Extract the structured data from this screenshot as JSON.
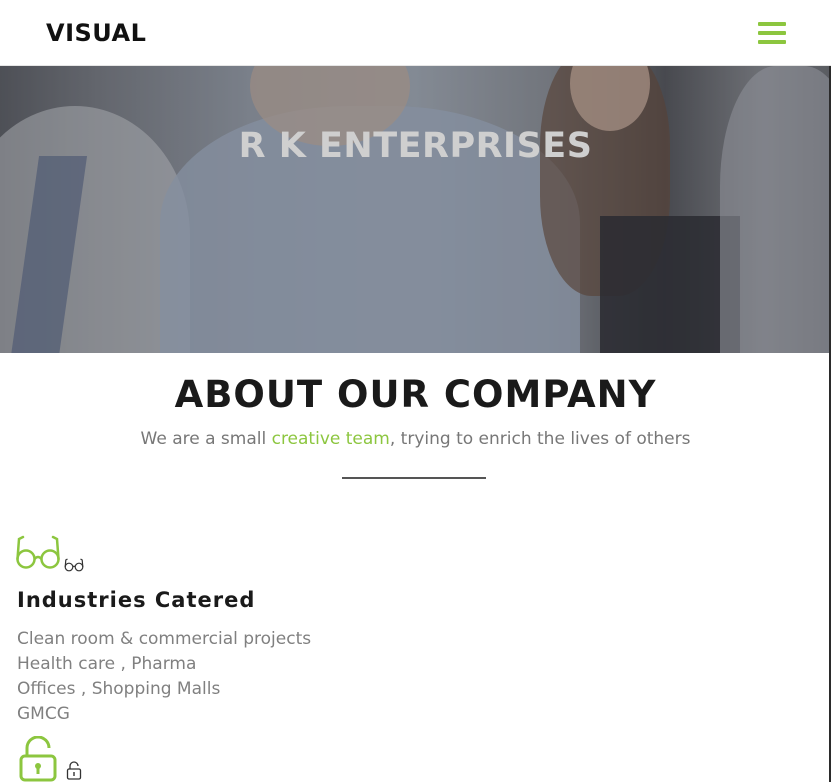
{
  "header": {
    "logo": "VISUAL",
    "menu_icon": "hamburger-menu-icon",
    "accent_color": "#8cc63f"
  },
  "hero": {
    "title": "R K ENTERPRISES"
  },
  "about": {
    "title": "ABOUT OUR COMPANY",
    "subtitle_before": "We are a small ",
    "subtitle_highlight": "creative team",
    "subtitle_after": ", trying to enrich the lives of others"
  },
  "features": {
    "icon_primary": "glasses-icon",
    "title": "Industries Catered",
    "items": [
      "Clean room & commercial projects",
      "Health care , Pharma",
      "Offices , Shopping Malls",
      "GMCG"
    ],
    "next_icon": "unlock-icon"
  }
}
